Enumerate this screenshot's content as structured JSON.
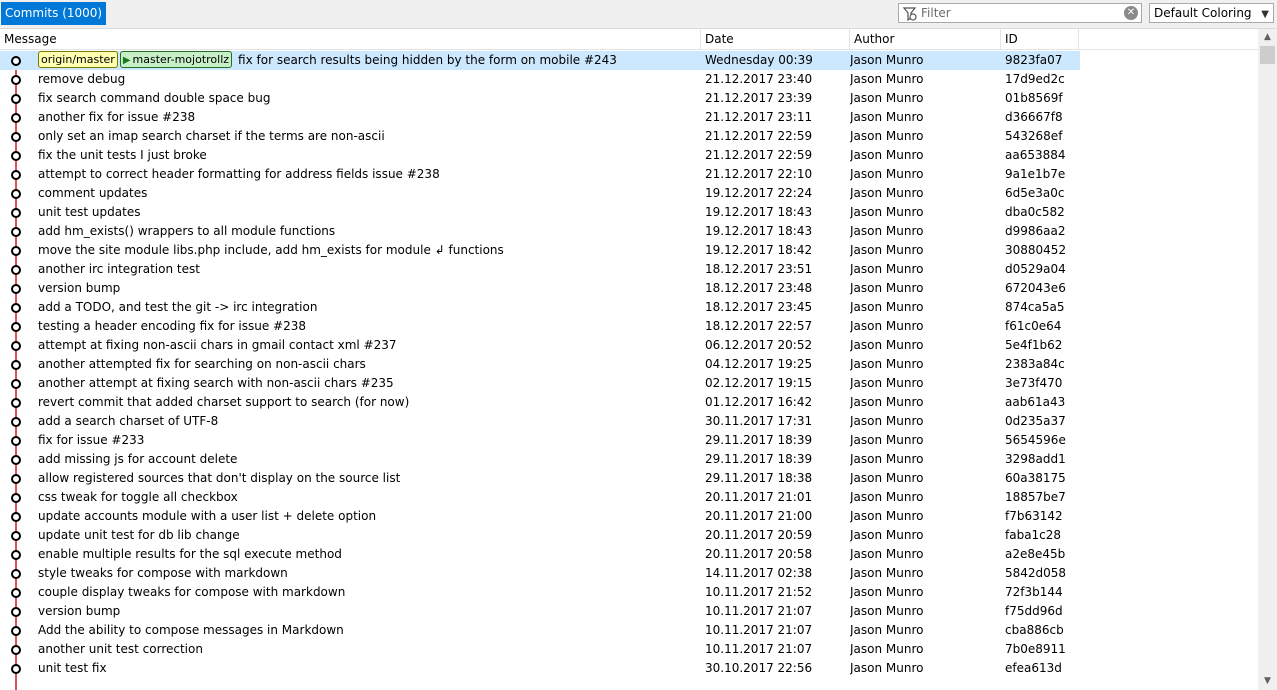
{
  "toolbar": {
    "tab_label": "Commits (1000)",
    "filter_placeholder": "Filter",
    "filter_value": "",
    "coloring_value": "Default Coloring"
  },
  "columns": {
    "message": "Message",
    "date": "Date",
    "author": "Author",
    "id": "ID"
  },
  "refs": {
    "remote": "origin/master",
    "local": "master-mojotrollz"
  },
  "colors": {
    "graph_line": "#e05050",
    "selection": "#cce8ff",
    "tab_active": "#0078d7"
  },
  "commits": [
    {
      "message": "fix for search results being hidden by the form on mobile #243",
      "date": "Wednesday 00:39",
      "author": "Jason Munro",
      "id": "9823fa07"
    },
    {
      "message": "remove debug",
      "date": "21.12.2017 23:40",
      "author": "Jason Munro",
      "id": "17d9ed2c"
    },
    {
      "message": "fix search command double space bug",
      "date": "21.12.2017 23:39",
      "author": "Jason Munro",
      "id": "01b8569f"
    },
    {
      "message": "another fix for issue #238",
      "date": "21.12.2017 23:11",
      "author": "Jason Munro",
      "id": "d36667f8"
    },
    {
      "message": "only set an imap search charset if the terms are non-ascii",
      "date": "21.12.2017 22:59",
      "author": "Jason Munro",
      "id": "543268ef"
    },
    {
      "message": "fix the unit tests I just broke",
      "date": "21.12.2017 22:59",
      "author": "Jason Munro",
      "id": "aa653884"
    },
    {
      "message": "attempt to correct header formatting for address fields issue #238",
      "date": "21.12.2017 22:10",
      "author": "Jason Munro",
      "id": "9a1e1b7e"
    },
    {
      "message": "comment updates",
      "date": "19.12.2017 22:24",
      "author": "Jason Munro",
      "id": "6d5e3a0c"
    },
    {
      "message": "unit test updates",
      "date": "19.12.2017 18:43",
      "author": "Jason Munro",
      "id": "dba0c582"
    },
    {
      "message": "add hm_exists() wrappers to all module functions",
      "date": "19.12.2017 18:43",
      "author": "Jason Munro",
      "id": "d9986aa2"
    },
    {
      "message": "move the site module libs.php include, add hm_exists for module ↲ functions",
      "date": "19.12.2017 18:42",
      "author": "Jason Munro",
      "id": "30880452"
    },
    {
      "message": "another irc integration test",
      "date": "18.12.2017 23:51",
      "author": "Jason Munro",
      "id": "d0529a04"
    },
    {
      "message": "version bump",
      "date": "18.12.2017 23:48",
      "author": "Jason Munro",
      "id": "672043e6"
    },
    {
      "message": "add a TODO, and test the git -> irc integration",
      "date": "18.12.2017 23:45",
      "author": "Jason Munro",
      "id": "874ca5a5"
    },
    {
      "message": "testing a header encoding fix for issue #238",
      "date": "18.12.2017 22:57",
      "author": "Jason Munro",
      "id": "f61c0e64"
    },
    {
      "message": "attempt at fixing non-ascii chars in gmail contact xml #237",
      "date": "06.12.2017 20:52",
      "author": "Jason Munro",
      "id": "5e4f1b62"
    },
    {
      "message": "another attempted fix for searching on non-ascii chars",
      "date": "04.12.2017 19:25",
      "author": "Jason Munro",
      "id": "2383a84c"
    },
    {
      "message": "another attempt at fixing search with non-ascii chars #235",
      "date": "02.12.2017 19:15",
      "author": "Jason Munro",
      "id": "3e73f470"
    },
    {
      "message": "revert commit that added charset support to search (for now)",
      "date": "01.12.2017 16:42",
      "author": "Jason Munro",
      "id": "aab61a43"
    },
    {
      "message": "add a search charset of UTF-8",
      "date": "30.11.2017 17:31",
      "author": "Jason Munro",
      "id": "0d235a37"
    },
    {
      "message": "fix for issue #233",
      "date": "29.11.2017 18:39",
      "author": "Jason Munro",
      "id": "5654596e"
    },
    {
      "message": "add missing js for account delete",
      "date": "29.11.2017 18:39",
      "author": "Jason Munro",
      "id": "3298add1"
    },
    {
      "message": "allow registered sources that don't display on the source list",
      "date": "29.11.2017 18:38",
      "author": "Jason Munro",
      "id": "60a38175"
    },
    {
      "message": "css tweak for toggle all checkbox",
      "date": "20.11.2017 21:01",
      "author": "Jason Munro",
      "id": "18857be7"
    },
    {
      "message": "update accounts module with a user list + delete option",
      "date": "20.11.2017 21:00",
      "author": "Jason Munro",
      "id": "f7b63142"
    },
    {
      "message": "update unit test for db lib change",
      "date": "20.11.2017 20:59",
      "author": "Jason Munro",
      "id": "faba1c28"
    },
    {
      "message": "enable multiple results for the sql execute method",
      "date": "20.11.2017 20:58",
      "author": "Jason Munro",
      "id": "a2e8e45b"
    },
    {
      "message": "style tweaks for compose with markdown",
      "date": "14.11.2017 02:38",
      "author": "Jason Munro",
      "id": "5842d058"
    },
    {
      "message": "couple display tweaks for compose with markdown",
      "date": "10.11.2017 21:52",
      "author": "Jason Munro",
      "id": "72f3b144"
    },
    {
      "message": "version bump",
      "date": "10.11.2017 21:07",
      "author": "Jason Munro",
      "id": "f75dd96d"
    },
    {
      "message": "Add the ability to compose messages in Markdown",
      "date": "10.11.2017 21:07",
      "author": "Jason Munro",
      "id": "cba886cb"
    },
    {
      "message": "another unit test correction",
      "date": "10.11.2017 21:07",
      "author": "Jason Munro",
      "id": "7b0e8911"
    },
    {
      "message": "unit test fix",
      "date": "30.10.2017 22:56",
      "author": "Jason Munro",
      "id": "efea613d"
    }
  ]
}
